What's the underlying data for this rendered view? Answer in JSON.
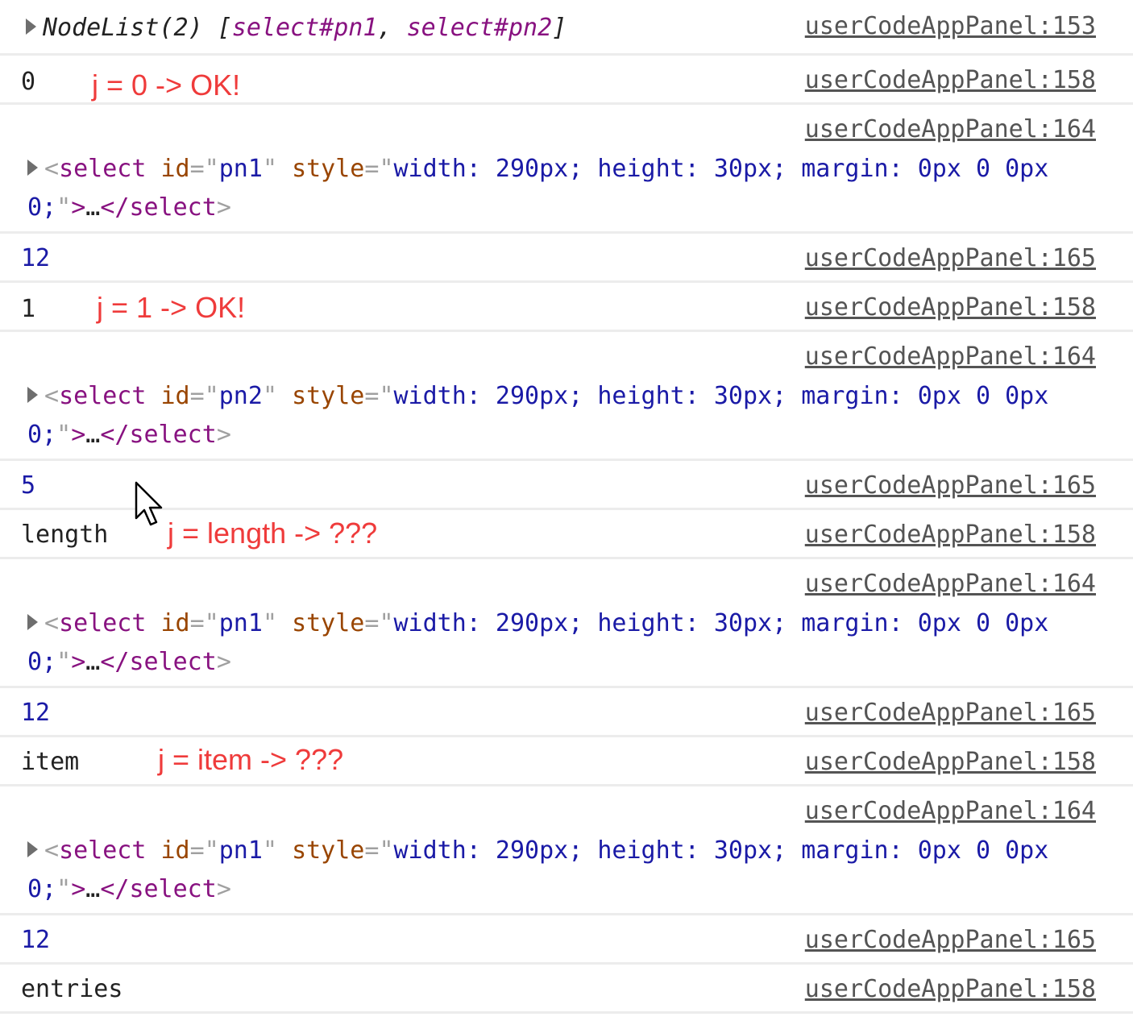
{
  "header": {
    "label": "NodeList(2)",
    "open": "[",
    "item1": "select#pn1",
    "sep": ", ",
    "item2": "select#pn2",
    "close": "]",
    "source": "userCodeAppPanel:153"
  },
  "element_line": {
    "open_bracket": "<",
    "tag": "select",
    "id_attr": "id",
    "eq": "=",
    "quote": "\"",
    "style_attr": "style",
    "style_value": "width: 290px; height: 30px; margin: 0px 0 0px 0;",
    "close_bracket": ">",
    "ellipsis": "…",
    "end_open": "</",
    "end_tag": "select",
    "end_close": ">"
  },
  "rows": [
    {
      "value": "0",
      "note": "j = 0 -> OK!",
      "source": "userCodeAppPanel:158"
    },
    {
      "element_id": "pn1",
      "source": "userCodeAppPanel:164"
    },
    {
      "value": "12",
      "source": "userCodeAppPanel:165"
    },
    {
      "value": "1",
      "note": "j = 1 -> OK!",
      "source": "userCodeAppPanel:158"
    },
    {
      "element_id": "pn2",
      "source": "userCodeAppPanel:164"
    },
    {
      "value": "5",
      "source": "userCodeAppPanel:165"
    },
    {
      "value": "length",
      "note": "j = length -> ???",
      "source": "userCodeAppPanel:158"
    },
    {
      "element_id": "pn1",
      "source": "userCodeAppPanel:164"
    },
    {
      "value": "12",
      "source": "userCodeAppPanel:165"
    },
    {
      "value": "item",
      "note": "j = item -> ???",
      "source": "userCodeAppPanel:158"
    },
    {
      "element_id": "pn1",
      "source": "userCodeAppPanel:164"
    },
    {
      "value": "12",
      "source": "userCodeAppPanel:165"
    },
    {
      "value": "entries",
      "source": "userCodeAppPanel:158"
    }
  ],
  "colors": {
    "note": "#ef3b3b",
    "number": "#1a1aa6",
    "tag": "#881280",
    "attr": "#994500"
  }
}
